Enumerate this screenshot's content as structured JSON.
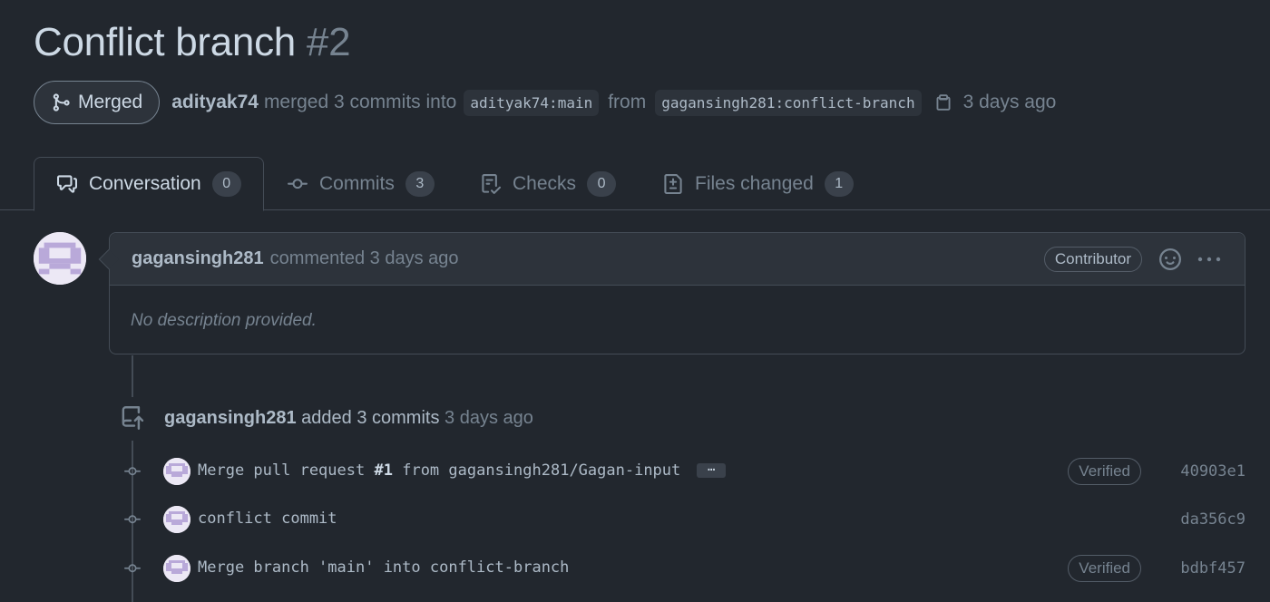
{
  "pr": {
    "title": "Conflict branch",
    "number": "#2",
    "status": "Merged",
    "author": "adityak74",
    "action": "merged 3 commits into",
    "base_branch": "adityak74:main",
    "from_word": "from",
    "head_branch": "gagansingh281:conflict-branch",
    "time": "3 days ago"
  },
  "tabs": [
    {
      "label": "Conversation",
      "count": "0",
      "icon": "comment-discussion-icon"
    },
    {
      "label": "Commits",
      "count": "3",
      "icon": "commit-icon"
    },
    {
      "label": "Checks",
      "count": "0",
      "icon": "checklist-icon"
    },
    {
      "label": "Files changed",
      "count": "1",
      "icon": "file-diff-icon"
    }
  ],
  "comment": {
    "author": "gagansingh281",
    "when": "commented 3 days ago",
    "role": "Contributor",
    "body": "No description provided."
  },
  "event": {
    "author": "gagansingh281",
    "action": "added 3 commits",
    "time": "3 days ago"
  },
  "commits": [
    {
      "msg_prefix": "Merge pull request",
      "msg_ref": "#1",
      "msg_suffix": "from gagansingh281/Gagan-input",
      "more": "…",
      "verified": "Verified",
      "sha": "40903e1"
    },
    {
      "msg": "conflict commit",
      "sha": "da356c9"
    },
    {
      "msg": "Merge branch 'main' into conflict-branch",
      "verified": "Verified",
      "sha": "bdbf457"
    }
  ],
  "colors": {
    "background": "#22272e",
    "border": "#444c56",
    "text_muted": "#768390",
    "text": "#adbac7"
  }
}
